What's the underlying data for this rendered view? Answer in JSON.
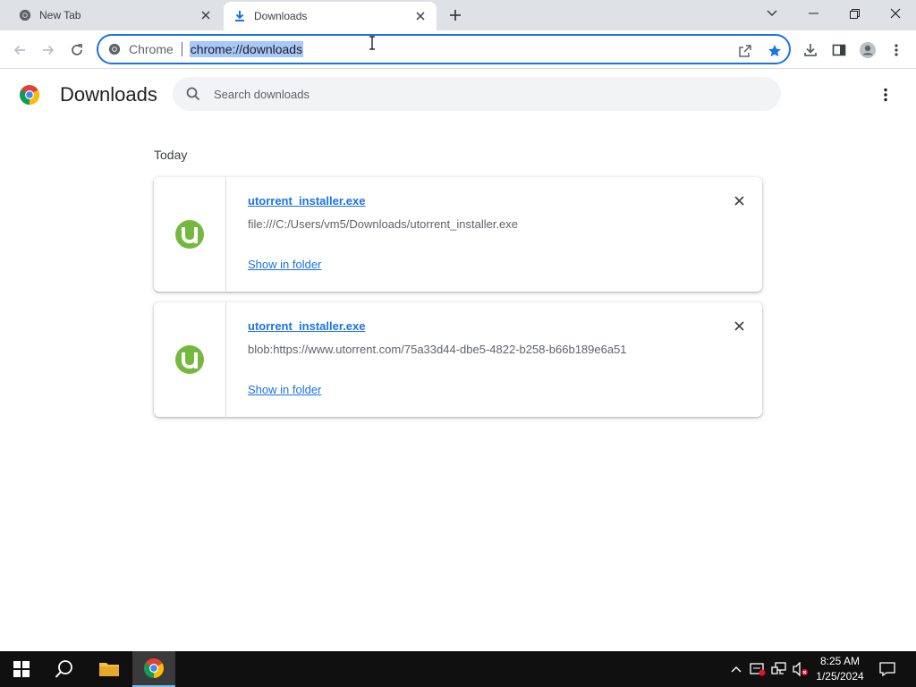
{
  "tabs": [
    {
      "title": "New Tab",
      "favicon": "chrome-icon"
    },
    {
      "title": "Downloads",
      "favicon": "download-icon",
      "active": true
    }
  ],
  "omnibox": {
    "chip_label": "Chrome",
    "url": "chrome://downloads"
  },
  "page": {
    "title": "Downloads",
    "search_placeholder": "Search downloads"
  },
  "downloads": {
    "section_label": "Today",
    "items": [
      {
        "file_name": "utorrent_installer.exe",
        "url": "file:///C:/Users/vm5/Downloads/utorrent_installer.exe",
        "action_label": "Show in folder",
        "icon": "utorrent-icon"
      },
      {
        "file_name": "utorrent_installer.exe",
        "url": "blob:https://www.utorrent.com/75a33d44-dbe5-4822-b258-b66b189e6a51",
        "action_label": "Show in folder",
        "icon": "utorrent-icon"
      }
    ]
  },
  "taskbar": {
    "time": "8:25 AM",
    "date": "1/25/2024"
  },
  "colors": {
    "accent": "#1a73e8",
    "utorrent_green": "#76b83f",
    "tabstrip": "#dee1e6",
    "taskbar": "#101010"
  }
}
